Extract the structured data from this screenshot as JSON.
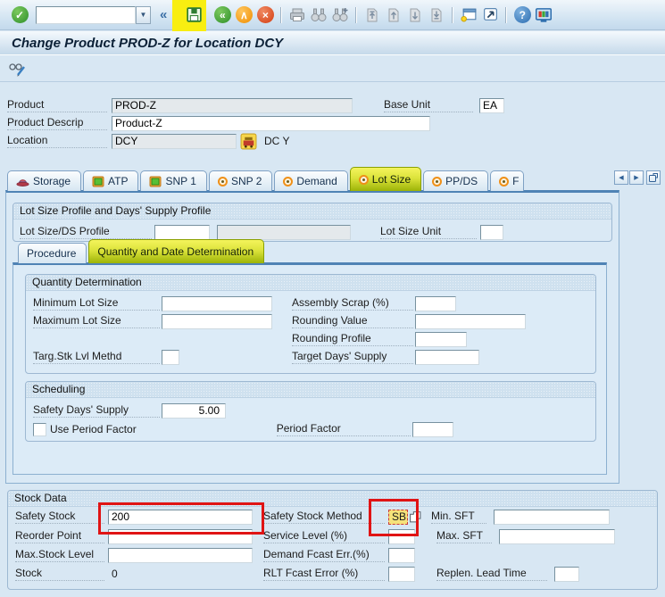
{
  "icons": {
    "check": "✓",
    "collapse": "«",
    "combo_arrow": "▼",
    "back": "«",
    "exit": "∧",
    "cancel": "×",
    "help": "?",
    "tab_left": "◀",
    "tab_right": "▶",
    "save": "floppy-disk",
    "print": "printer",
    "find": "binoculars",
    "find_next": "binoculars-plus",
    "first_page": "page-first",
    "prev_page": "page-up",
    "next_page": "page-down",
    "last_page": "page-last",
    "new_session": "window-star",
    "shortcut": "window-arrow",
    "customize": "monitor",
    "display_change": "glasses-pencil",
    "storage_tab": "red-hat",
    "monitor_tab": "mini-monitor",
    "radio_tab": "orange-radio-dot",
    "location": "yellow-depot",
    "matchcode": "overlapping-squares"
  },
  "toolbar": {
    "command_value": ""
  },
  "title": "Change Product PROD-Z for Location DCY",
  "header": {
    "product_label": "Product",
    "product_value": "PROD-Z",
    "descrip_label": "Product Descrip",
    "descrip_value": "Product-Z",
    "location_label": "Location",
    "location_value": "DCY",
    "location_text": "DC Y",
    "base_unit_label": "Base Unit",
    "base_unit_value": "EA"
  },
  "tabs": {
    "items": [
      {
        "label": "Storage"
      },
      {
        "label": "ATP"
      },
      {
        "label": "SNP 1"
      },
      {
        "label": "SNP 2"
      },
      {
        "label": "Demand"
      },
      {
        "label": "Lot Size",
        "active": true,
        "highlighted": true
      },
      {
        "label": "PP/DS"
      },
      {
        "label": "F"
      }
    ]
  },
  "lot_size_profile": {
    "group_title": "Lot Size Profile and Days' Supply Profile",
    "profile_label": "Lot Size/DS Profile",
    "profile_value": "",
    "profile_desc": "",
    "unit_label": "Lot Size Unit",
    "unit_value": ""
  },
  "inner_tabs": {
    "procedure": "Procedure",
    "qdd": "Quantity and Date Determination",
    "qdd_highlighted": true
  },
  "quantity_determination": {
    "group_title": "Quantity Determination",
    "min_lot_label": "Minimum Lot Size",
    "max_lot_label": "Maximum Lot Size",
    "targ_stk_label": "Targ.Stk Lvl Methd",
    "assembly_scrap_label": "Assembly Scrap (%)",
    "rounding_value_label": "Rounding Value",
    "rounding_profile_label": "Rounding Profile",
    "target_days_label": "Target Days' Supply"
  },
  "scheduling": {
    "group_title": "Scheduling",
    "safety_days_label": "Safety Days' Supply",
    "safety_days_value": "5.00",
    "use_period_factor_label": "Use Period Factor",
    "use_period_factor_checked": false,
    "period_factor_label": "Period Factor"
  },
  "stock_data": {
    "group_title": "Stock Data",
    "safety_stock_label": "Safety Stock",
    "safety_stock_value": "200",
    "safety_stock_method_label": "Safety Stock Method",
    "safety_stock_method_value": "SB",
    "min_sft_label": "Min. SFT",
    "reorder_point_label": "Reorder Point",
    "service_level_label": "Service Level (%)",
    "max_sft_label": "Max. SFT",
    "max_stock_level_label": "Max.Stock Level",
    "demand_fcast_label": "Demand Fcast Err.(%)",
    "stock_label": "Stock",
    "stock_value": "0",
    "rlt_fcast_label": "RLT Fcast Error (%)",
    "replen_lead_label": "Replen. Lead Time"
  }
}
